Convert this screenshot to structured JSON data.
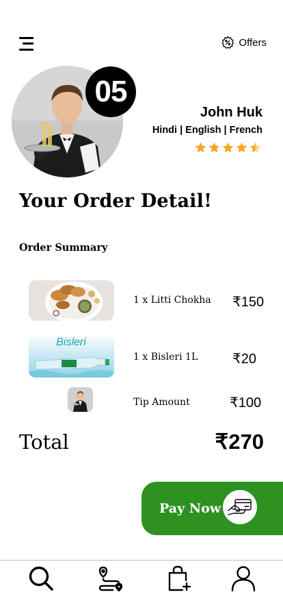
{
  "header": {
    "offers_label": "Offers"
  },
  "waiter": {
    "badge_number": "05",
    "name": "John Huk",
    "languages": "Hindi | English | French",
    "rating": 4.5
  },
  "page": {
    "title": "Your Order Detail!",
    "summary_title": "Order Summary"
  },
  "order_items": [
    {
      "name": "1 x  Litti Chokha",
      "price": "₹150"
    },
    {
      "name": "1 x  Bisleri 1L",
      "price": "₹20"
    },
    {
      "name": "Tip Amount",
      "price": "₹100"
    }
  ],
  "total": {
    "label": "Total",
    "value": "₹270"
  },
  "pay_button": {
    "label": "Pay Now"
  },
  "colors": {
    "accent_green": "#2e9221",
    "star": "#f5a623"
  },
  "nav": {
    "items": [
      {
        "icon": "search-icon"
      },
      {
        "icon": "route-icon"
      },
      {
        "icon": "cart-bag-icon"
      },
      {
        "icon": "profile-icon"
      }
    ]
  }
}
